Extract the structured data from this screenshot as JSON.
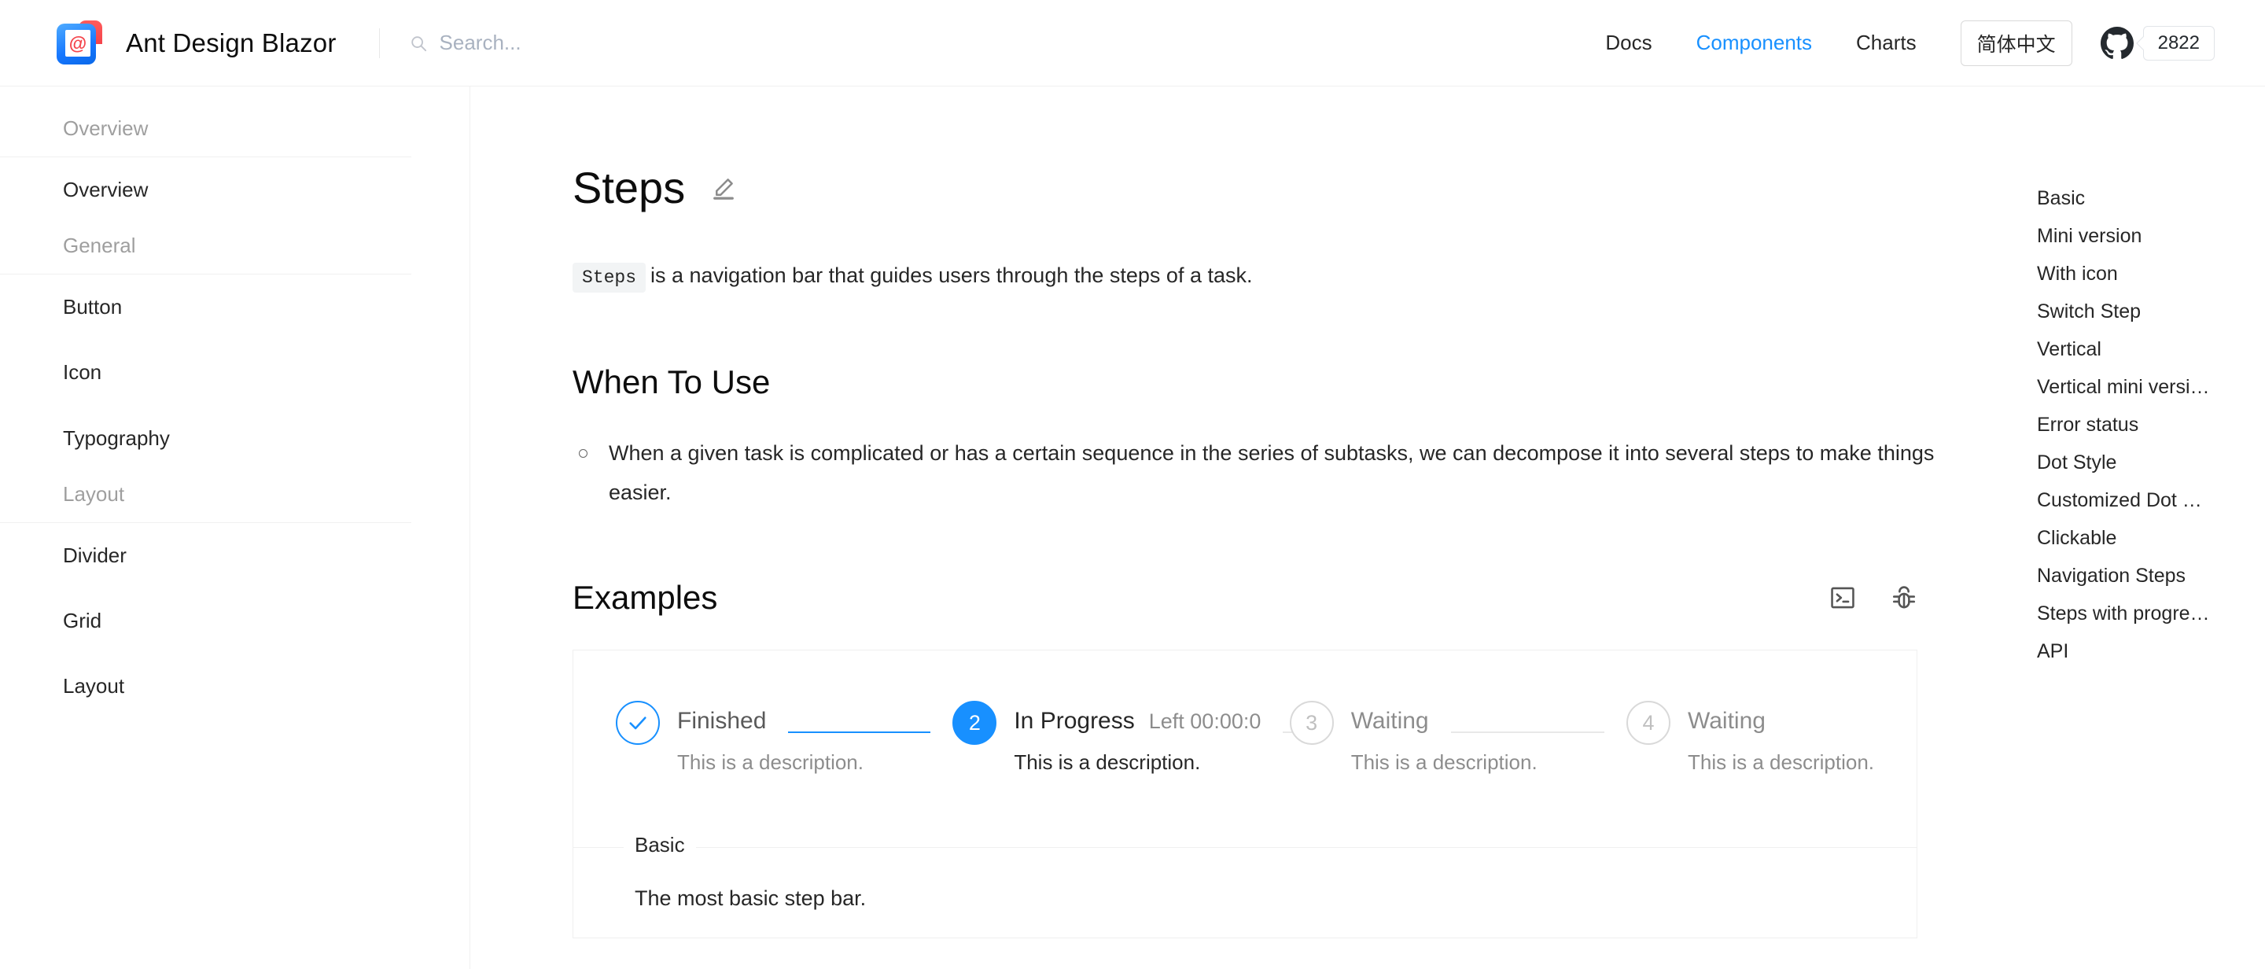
{
  "header": {
    "brand_title": "Ant Design Blazor",
    "logo_icon": "ant-design-blazor-logo",
    "search": {
      "placeholder": "Search...",
      "value": "",
      "icon": "search-icon"
    },
    "nav": [
      {
        "label": "Docs",
        "active": false
      },
      {
        "label": "Components",
        "active": true
      },
      {
        "label": "Charts",
        "active": false
      }
    ],
    "language_button": "简体中文",
    "github": {
      "icon": "github-icon",
      "stars": "2822"
    }
  },
  "sidebar": {
    "groups": [
      {
        "title": "Overview",
        "items": [
          "Overview"
        ]
      },
      {
        "title": "General",
        "items": [
          "Button",
          "Icon",
          "Typography"
        ]
      },
      {
        "title": "Layout",
        "items": [
          "Divider",
          "Grid",
          "Layout"
        ]
      }
    ]
  },
  "main": {
    "page_title": "Steps",
    "edit_icon": "pencil-edit-icon",
    "intro_code": "Steps",
    "intro_text": "is a navigation bar that guides users through the steps of a task.",
    "when_to_use_heading": "When To Use",
    "when_to_use_bullets": [
      "When a given task is complicated or has a certain sequence in the series of subtasks, we can decompose it into several steps to make things easier."
    ],
    "examples_heading": "Examples",
    "examples_icons": [
      {
        "name": "code-terminal-icon"
      },
      {
        "name": "bug-icon"
      }
    ],
    "demo": {
      "steps": [
        {
          "index": "1",
          "status": "finish",
          "icon": "check-icon",
          "title": "Finished",
          "subtitle": "",
          "description": "This is a description.",
          "tail": "done"
        },
        {
          "index": "2",
          "status": "process",
          "icon": "",
          "title": "In Progress",
          "subtitle": "Left 00:00:0",
          "description": "This is a description.",
          "tail": "pending"
        },
        {
          "index": "3",
          "status": "wait",
          "icon": "",
          "title": "Waiting",
          "subtitle": "",
          "description": "This is a description.",
          "tail": "pending"
        },
        {
          "index": "4",
          "status": "wait",
          "icon": "",
          "title": "Waiting",
          "subtitle": "",
          "description": "This is a description.",
          "tail": ""
        }
      ],
      "legend": "Basic",
      "note": "The most basic step bar."
    }
  },
  "toc": {
    "items": [
      "Basic",
      "Mini version",
      "With icon",
      "Switch Step",
      "Vertical",
      "Vertical mini versi…",
      "Error status",
      "Dot Style",
      "Customized Dot …",
      "Clickable",
      "Navigation Steps",
      "Steps with progre…",
      "API"
    ]
  },
  "colors": {
    "accent": "#1890ff",
    "link_active": "#1890ff",
    "logo_blue": "#1677ff",
    "logo_red": "#f4444b",
    "border": "#f0f0f0",
    "text": "rgba(0,0,0,0.85)",
    "muted": "rgba(0,0,0,0.45)"
  }
}
